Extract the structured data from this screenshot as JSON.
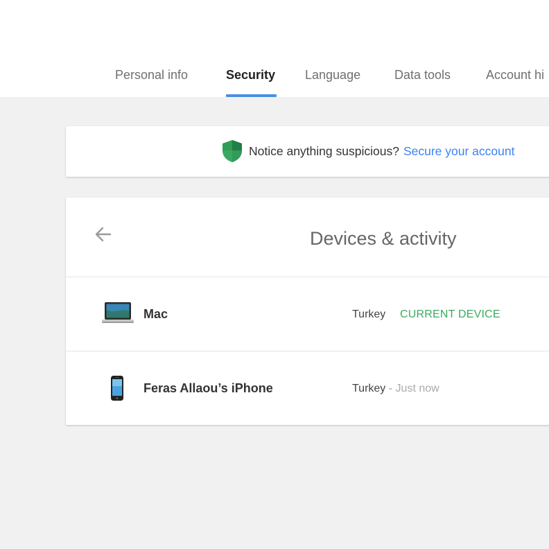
{
  "tabs": [
    {
      "label": "Personal info",
      "active": false
    },
    {
      "label": "Security",
      "active": true
    },
    {
      "label": "Language",
      "active": false
    },
    {
      "label": "Data tools",
      "active": false
    },
    {
      "label": "Account hi",
      "active": false
    }
  ],
  "notice": {
    "icon": "shield-icon",
    "text": "Notice anything suspicious?",
    "link": "Secure your account"
  },
  "devices": {
    "title": "Devices & activity",
    "back_icon": "arrow-left-icon",
    "items": [
      {
        "name": "Mac",
        "icon": "laptop-icon",
        "location": "Turkey",
        "status": "CURRENT DEVICE"
      },
      {
        "name": "Feras Allaou’s iPhone",
        "icon": "phone-icon",
        "location": "Turkey",
        "separator": "-",
        "time": "Just now"
      }
    ]
  },
  "colors": {
    "accent": "#4a90e2",
    "link": "#3b82f6",
    "current_device": "#3aaa5c",
    "shield": "#2e9e57",
    "background": "#f1f1f1"
  }
}
